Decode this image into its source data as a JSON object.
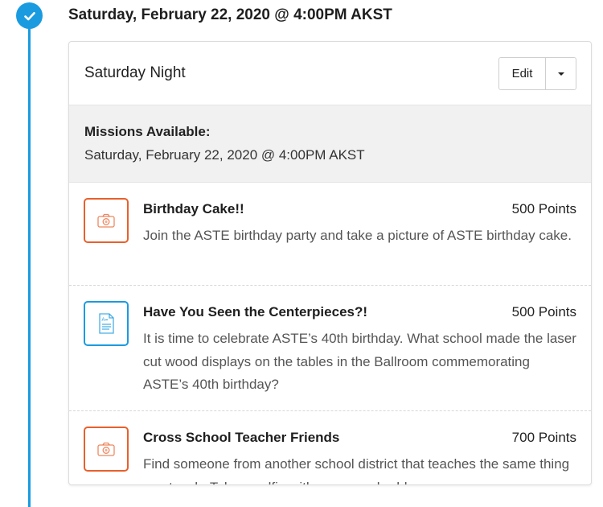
{
  "timeline": {
    "date_heading": "Saturday, February 22, 2020 @ 4:00PM AKST",
    "accent_color": "#1a9be0"
  },
  "card": {
    "title": "Saturday Night",
    "edit_label": "Edit",
    "availability": {
      "label": "Missions Available:",
      "date": "Saturday, February 22, 2020 @ 4:00PM AKST"
    },
    "missions": [
      {
        "title": "Birthday Cake!!",
        "points": "500 Points",
        "description": "Join the ASTE birthday party and take a picture of ASTE birthday cake.",
        "icon": "camera-icon",
        "icon_color": "#e8602c"
      },
      {
        "title": "Have You Seen the Centerpieces?!",
        "points": "500 Points",
        "description": "It is time to celebrate ASTE’s 40th birthday. What school made the laser cut wood displays on the tables in the Ballroom commemorating ASTE’s 40th birthday?",
        "icon": "document-icon",
        "icon_color": "#1a9be0"
      },
      {
        "title": "Cross School Teacher Friends",
        "points": "700 Points",
        "description": "Find someone from another school district that teaches the same thing you teach. Take a selfie with your new buddy.",
        "icon": "camera-icon",
        "icon_color": "#e8602c"
      }
    ]
  }
}
